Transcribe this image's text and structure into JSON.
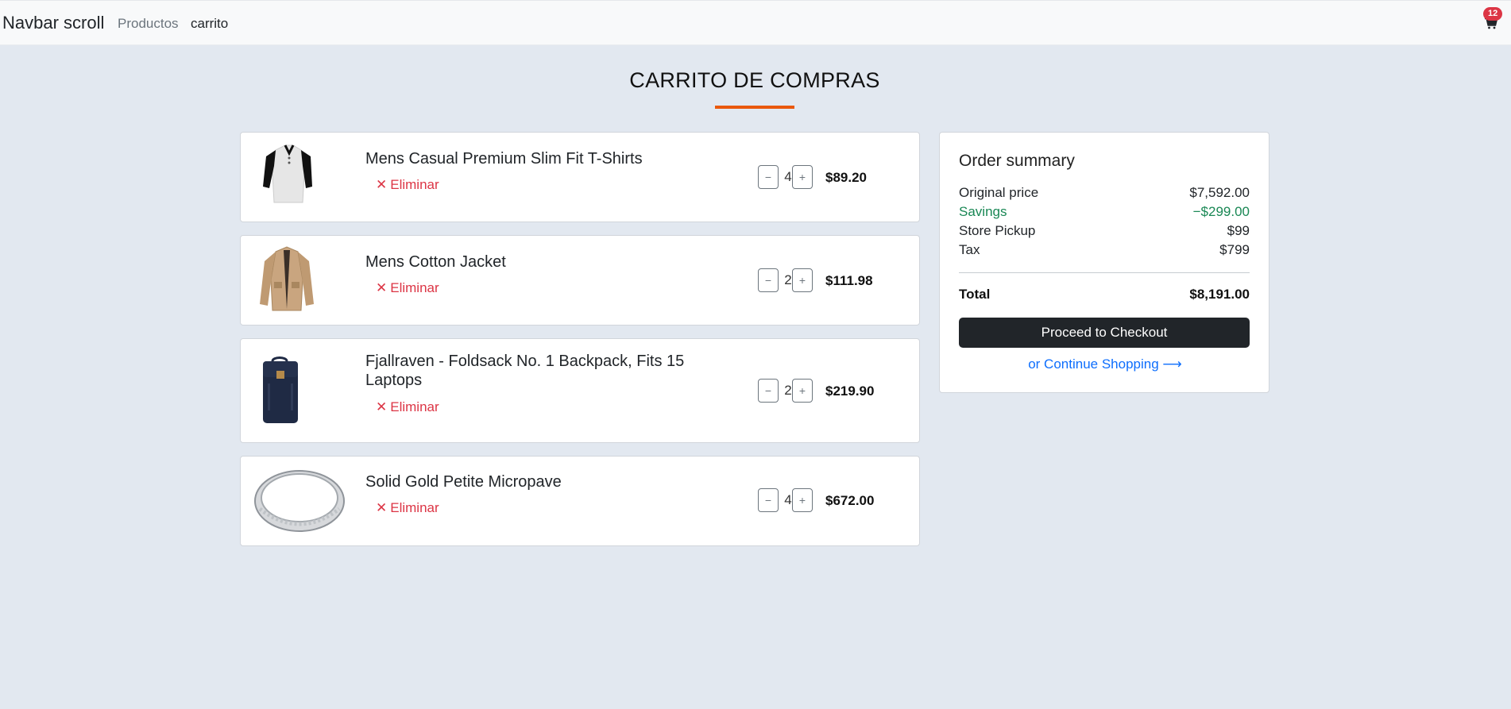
{
  "navbar": {
    "brand": "Navbar scroll",
    "links": [
      {
        "label": "Productos"
      },
      {
        "label": "carrito"
      }
    ],
    "cart_count": "12",
    "cart_icon": "shopping-cart-icon"
  },
  "page": {
    "title": "CARRITO DE COMPRAS",
    "accent_color": "#ea580c"
  },
  "cart": {
    "remove_label": "Eliminar",
    "items": [
      {
        "name": "Mens Casual Premium Slim Fit T-Shirts",
        "quantity": "4",
        "price": "$89.20",
        "image_icon": "tshirt-image"
      },
      {
        "name": "Mens Cotton Jacket",
        "quantity": "2",
        "price": "$111.98",
        "image_icon": "jacket-image"
      },
      {
        "name": "Fjallraven - Foldsack No. 1 Backpack, Fits 15 Laptops",
        "quantity": "2",
        "price": "$219.90",
        "image_icon": "backpack-image"
      },
      {
        "name": "Solid Gold Petite Micropave",
        "quantity": "4",
        "price": "$672.00",
        "image_icon": "ring-image"
      }
    ]
  },
  "summary": {
    "title": "Order summary",
    "rows": [
      {
        "label": "Original price",
        "value": "$7,592.00"
      },
      {
        "label": "Savings",
        "value": "−$299.00"
      },
      {
        "label": "Store Pickup",
        "value": "$99"
      },
      {
        "label": "Tax",
        "value": "$799"
      }
    ],
    "total_label": "Total",
    "total_value": "$8,191.00",
    "checkout_label": "Proceed to Checkout",
    "continue_label": "or Continue Shopping ⟶",
    "savings_color": "#198754"
  }
}
